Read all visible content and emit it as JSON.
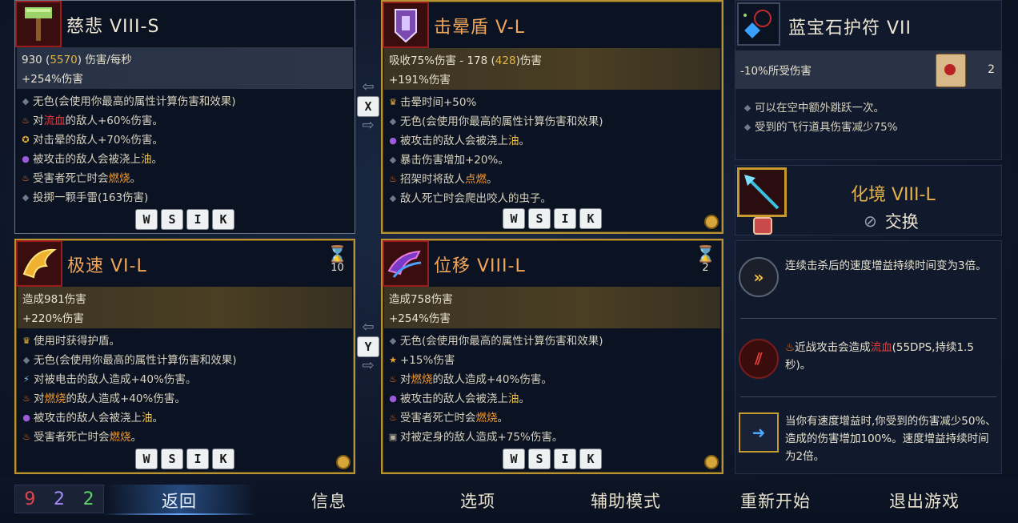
{
  "cards": {
    "c1": {
      "title": "慈悲 VIII-S",
      "stat1_a": "930 (",
      "stat1_b": "5570",
      "stat1_c": ") 伤害/每秒",
      "stat2": "+254%伤害",
      "effects": [
        {
          "icon": "dot-icon",
          "pre": "无色(会使用你最高的属性计算伤害和效果)",
          "hl": "",
          "post": ""
        },
        {
          "icon": "fire-icon",
          "pre": "对",
          "hl": "流血",
          "post": "的敌人+60%伤害。"
        },
        {
          "icon": "stun-icon",
          "pre": "对击晕的敌人+70%伤害。",
          "hl": "",
          "post": ""
        },
        {
          "icon": "oil-icon",
          "pre": "被攻击的敌人会被浇上",
          "hl": "油",
          "post": "。"
        },
        {
          "icon": "fire-icon",
          "pre": "受害者死亡时会",
          "hl": "燃烧",
          "post": "。"
        },
        {
          "icon": "dot-icon",
          "pre": "投掷一颗手雷(163伤害)",
          "hl": "",
          "post": ""
        }
      ],
      "keys": [
        "W",
        "S",
        "I",
        "K"
      ]
    },
    "c2": {
      "title": "击晕盾 V-L",
      "stat1_a": "吸收75%伤害 - 178 (",
      "stat1_b": "428",
      "stat1_c": ")伤害",
      "stat2": "+191%伤害",
      "effects": [
        {
          "icon": "crown-icon",
          "pre": "击晕时间+50%",
          "hl": "",
          "post": ""
        },
        {
          "icon": "dot-icon",
          "pre": "无色(会使用你最高的属性计算伤害和效果)",
          "hl": "",
          "post": ""
        },
        {
          "icon": "oil-icon",
          "pre": "被攻击的敌人会被浇上",
          "hl": "油",
          "post": "。"
        },
        {
          "icon": "dot-icon",
          "pre": "暴击伤害增加+20%。",
          "hl": "",
          "post": ""
        },
        {
          "icon": "fire-icon",
          "pre": "招架时将敌人",
          "hl": "点燃",
          "post": "。"
        },
        {
          "icon": "dot-icon",
          "pre": "敌人死亡时会爬出咬人的虫子。",
          "hl": "",
          "post": ""
        }
      ],
      "keys": [
        "W",
        "S",
        "I",
        "K"
      ]
    },
    "c3": {
      "title": "极速 VI-L",
      "stat1": "造成981伤害",
      "stat2": "+220%伤害",
      "cooldown": "10",
      "effects": [
        {
          "icon": "crown-icon",
          "pre": "使用时获得护盾。",
          "hl": "",
          "post": ""
        },
        {
          "icon": "dot-icon",
          "pre": "无色(会使用你最高的属性计算伤害和效果)",
          "hl": "",
          "post": ""
        },
        {
          "icon": "bolt-icon",
          "pre": "对被电击的敌人造成+40%伤害。",
          "hl": "",
          "post": ""
        },
        {
          "icon": "fire-icon",
          "pre": "对",
          "hl": "燃烧",
          "post": "的敌人造成+40%伤害。"
        },
        {
          "icon": "oil-icon",
          "pre": "被攻击的敌人会被浇上",
          "hl": "油",
          "post": "。"
        },
        {
          "icon": "fire-icon",
          "pre": "受害者死亡时会",
          "hl": "燃烧",
          "post": "。"
        }
      ],
      "keys": [
        "W",
        "S",
        "I",
        "K"
      ]
    },
    "c4": {
      "title": "位移 VIII-L",
      "stat1": "造成758伤害",
      "stat2": "+254%伤害",
      "cooldown": "2",
      "effects": [
        {
          "icon": "dot-icon",
          "pre": "无色(会使用你最高的属性计算伤害和效果)",
          "hl": "",
          "post": ""
        },
        {
          "icon": "star-icon",
          "pre": "+15%伤害",
          "hl": "",
          "post": ""
        },
        {
          "icon": "fire-icon",
          "pre": "对",
          "hl": "燃烧",
          "post": "的敌人造成+40%伤害。"
        },
        {
          "icon": "oil-icon",
          "pre": "被攻击的敌人会被浇上",
          "hl": "油",
          "post": "。"
        },
        {
          "icon": "fire-icon",
          "pre": "受害者死亡时会",
          "hl": "燃烧",
          "post": "。"
        },
        {
          "icon": "lock-icon",
          "pre": "对被定身的敌人造成+75%伤害。",
          "hl": "",
          "post": ""
        }
      ],
      "keys": [
        "W",
        "S",
        "I",
        "K"
      ]
    }
  },
  "swap": {
    "x_key": "X",
    "y_key": "Y"
  },
  "amulet": {
    "title": "蓝宝石护符 VII",
    "stat": "-10%所受伤害",
    "scroll_count": "2",
    "effects": [
      "可以在空中额外跳跃一次。",
      "受到的飞行道具伤害减少75%"
    ]
  },
  "skin": {
    "title": "化境 VIII-L",
    "action": "交换"
  },
  "perks": [
    {
      "icon": "speed-chevron-icon",
      "text": "连续击杀后的速度增益持续时间变为3倍。"
    },
    {
      "icon": "bleed-slash-icon",
      "pre": "近战攻击会造成",
      "hl": "流血",
      "post": "(55DPS,持续1.5秒)。"
    },
    {
      "icon": "dash-arrow-icon",
      "text": "当你有速度增益时,你受到的伤害减少50%、造成的伤害增加100%。速度增益持续时间为2倍。"
    }
  ],
  "scrolls": {
    "brutality": "9",
    "tactics": "2",
    "survival": "2"
  },
  "menu": {
    "back": "返回",
    "info": "信息",
    "options": "选项",
    "assist": "辅助模式",
    "restart": "重新开始",
    "quit": "退出游戏"
  },
  "colors": {
    "gold_border": "#b89334",
    "legendary_title": "#f1a65a",
    "brutality": "#e0454a",
    "tactics": "#a78bfa",
    "survival": "#5ed36a"
  }
}
